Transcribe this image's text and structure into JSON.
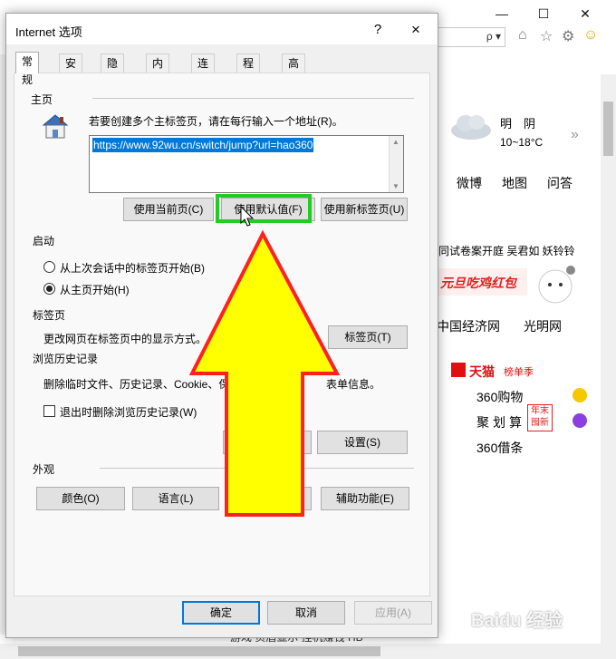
{
  "dialog": {
    "title": "Internet 选项",
    "help": "?",
    "close": "×",
    "tabs": [
      "常规",
      "安全",
      "隐私",
      "内容",
      "连接",
      "程序",
      "高级"
    ],
    "home": {
      "label": "主页",
      "hint": "若要创建多个主标签页，请在每行输入一个地址(R)。",
      "url": "https://www.92wu.cn/switch/jump?url=hao360",
      "btn_current": "使用当前页(C)",
      "btn_default": "使用默认值(F)",
      "btn_newtab": "使用新标签页(U)"
    },
    "startup": {
      "label": "启动",
      "opt1": "从上次会话中的标签页开始(B)",
      "opt2": "从主页开始(H)"
    },
    "tabs_section": {
      "label": "标签页",
      "desc": "更改网页在标签页中的显示方式。",
      "btn": "标签页(T)"
    },
    "history": {
      "label": "浏览历史记录",
      "desc_left": "删除临时文件、历史记录、Cookie、保",
      "desc_right": "表单信息。",
      "checkbox": "退出时删除浏览历史记录(W)",
      "btn_settings": "设置(S)"
    },
    "appearance": {
      "label": "外观",
      "btn_colors": "颜色(O)",
      "btn_language": "语言(L)",
      "btn_access": "辅助功能(E)"
    },
    "footer": {
      "ok": "确定",
      "cancel": "取消",
      "apply": "应用(A)"
    }
  },
  "browser": {
    "window_controls": [
      "—",
      "☐",
      "✕"
    ],
    "address_dropdown": "ρ ▾",
    "weather_condition": "明　阴",
    "weather_temp": "10~18°C",
    "nav_links": [
      "微博",
      "地图",
      "问答"
    ],
    "news_ticker": "同试卷案开庭  吴君如 妖铃铃",
    "banner": "元旦吃鸡红包",
    "site_links": [
      "中国经济网",
      "光明网"
    ],
    "tmall_name": "天猫",
    "tmall_sub": "榜单季",
    "items": [
      "360购物",
      "聚划算",
      "360借条"
    ],
    "badge": "年末\n囤新",
    "bottom_text": "游戏   页眉显示   挂机赚钱 HB",
    "watermark": "Baidu 经验"
  },
  "colors": {
    "highlight_box": "#22cc22",
    "arrow_fill": "#ffff00",
    "arrow_stroke": "#ff2020",
    "selection": "#0078d7"
  }
}
